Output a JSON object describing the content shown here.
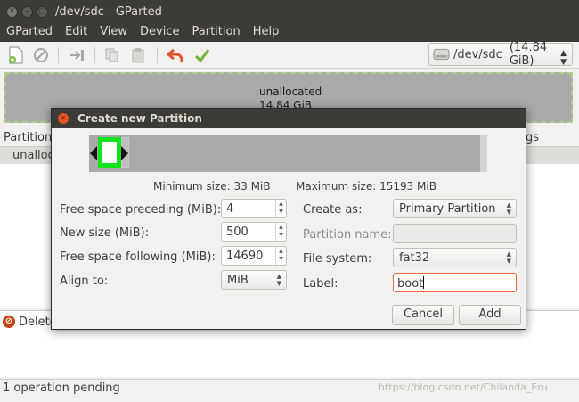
{
  "window": {
    "title": "/dev/sdc - GParted"
  },
  "menu": [
    "GParted",
    "Edit",
    "View",
    "Device",
    "Partition",
    "Help"
  ],
  "toolbar": {
    "icons": [
      "new-icon",
      "delete-icon",
      "resize-move-icon",
      "copy-icon",
      "paste-icon",
      "undo-icon",
      "apply-icon"
    ],
    "device": "/dev/sdc",
    "device_size": "(14.84 GiB)"
  },
  "disk_map": {
    "label": "unallocated",
    "size": "14.84 GiB"
  },
  "table": {
    "col_partition": "Partition",
    "col_flags": "gs",
    "row_name": "unalloc"
  },
  "pending": {
    "text": "Delete"
  },
  "status": "1 operation pending",
  "watermark": "https://blog.csdn.net/Chilanda_Eru",
  "dialog": {
    "title": "Create new Partition",
    "min_size": "Minimum size: 33 MiB",
    "max_size": "Maximum size: 15193 MiB",
    "free_preceding_label": "Free space preceding (MiB):",
    "free_preceding_value": "4",
    "new_size_label": "New size (MiB):",
    "new_size_value": "500",
    "free_following_label": "Free space following (MiB):",
    "free_following_value": "14690",
    "align_label": "Align to:",
    "align_value": "MiB",
    "create_as_label": "Create as:",
    "create_as_value": "Primary Partition",
    "partition_name_label": "Partition name:",
    "file_system_label": "File system:",
    "file_system_value": "fat32",
    "label_label": "Label:",
    "label_value": "boot",
    "cancel": "Cancel",
    "add": "Add"
  }
}
